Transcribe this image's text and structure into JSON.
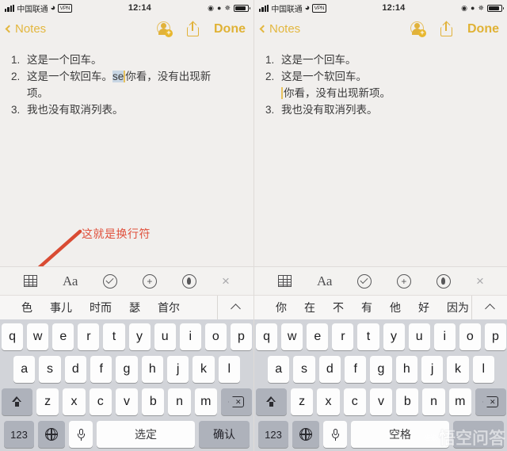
{
  "meta": {
    "app": "Notes",
    "watermark": "悟空问答",
    "watermark_logo": "cloud-icon"
  },
  "status_bar": {
    "signal_icon": "signal-bars-icon",
    "carrier": "中国联通",
    "wifi_icon": "wifi-icon",
    "vpn_label": "VPN",
    "time": "12:14",
    "lock_rotation_icon": "rotation-lock-icon",
    "alarm_icon": "alarm-icon",
    "bluetooth_icon": "bluetooth-icon",
    "battery_icon": "battery-icon"
  },
  "nav_bar": {
    "back_label": "Notes",
    "back_icon": "chevron-left-icon",
    "add_user_icon": "add-user-icon",
    "share_icon": "share-icon",
    "done_label": "Done"
  },
  "left_note": {
    "lines": [
      {
        "num": "1.",
        "text": "这是一个回车。"
      },
      {
        "num": "2.",
        "text_before": "这是一个软回车。",
        "selection": "se",
        "text_after": "你看，没有出现新"
      },
      {
        "num": "",
        "text": "项。"
      },
      {
        "num": "3.",
        "text": "我也没有取消列表。"
      }
    ]
  },
  "right_note": {
    "lines": [
      {
        "num": "1.",
        "text": "这是一个回车。"
      },
      {
        "num": "2.",
        "text": "这是一个软回车。"
      },
      {
        "num": "",
        "text": "你看，没有出现新项。",
        "caret_before": true
      },
      {
        "num": "3.",
        "text": "我也没有取消列表。"
      }
    ]
  },
  "annotation": {
    "text": "这就是换行符",
    "color": "#e0503c",
    "shape": "arrow-with-circle"
  },
  "keyboard_toolbar": {
    "items": [
      {
        "icon": "table-icon",
        "label": ""
      },
      {
        "icon": "text-format-icon",
        "label": "Aa"
      },
      {
        "icon": "checklist-icon",
        "label": ""
      },
      {
        "icon": "add-attachment-icon",
        "label": ""
      },
      {
        "icon": "markup-pen-icon",
        "label": ""
      },
      {
        "icon": "close-keyboard-icon",
        "label": "×"
      }
    ]
  },
  "left_candidates": {
    "items": [
      "色",
      "事儿",
      "时而",
      "瑟",
      "首尔"
    ],
    "expand_icon": "chevron-up-icon"
  },
  "right_candidates": {
    "items": [
      "你",
      "在",
      "不",
      "有",
      "他",
      "好",
      "因为"
    ],
    "expand_icon": "chevron-up-icon"
  },
  "keyboard": {
    "row1": [
      "q",
      "w",
      "e",
      "r",
      "t",
      "y",
      "u",
      "i",
      "o",
      "p"
    ],
    "row2": [
      "a",
      "s",
      "d",
      "f",
      "g",
      "h",
      "j",
      "k",
      "l"
    ],
    "row3": [
      "z",
      "x",
      "c",
      "v",
      "b",
      "n",
      "m"
    ],
    "shift_icon": "shift-icon",
    "delete_icon": "delete-icon",
    "numbers_label": "123",
    "globe_icon": "globe-icon",
    "mic_icon": "microphone-icon",
    "left_space_label": "选定",
    "left_enter_label": "确认",
    "right_space_label": "空格"
  }
}
